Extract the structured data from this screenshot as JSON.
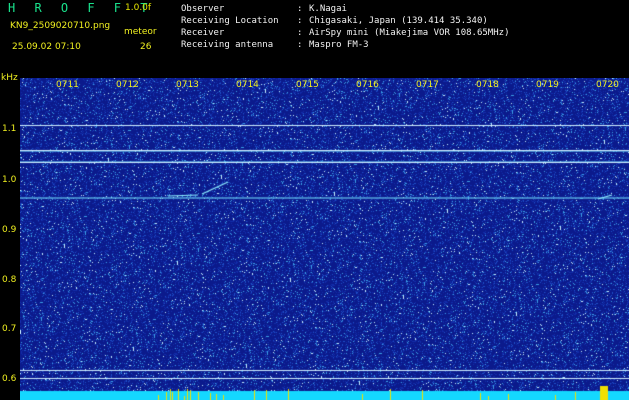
{
  "header": {
    "app_title": "H R O F F T",
    "version": "1.0.0f",
    "filename": "KN9_2509020710.png",
    "datetime": "25.09.02 07:10",
    "meteor_label": "meteor",
    "meteor_count": "26"
  },
  "info": [
    {
      "key": "Observer",
      "value": "K.Nagai"
    },
    {
      "key": "Receiving Location",
      "value": "Chigasaki, Japan (139.414 35.340)"
    },
    {
      "key": "Receiver",
      "value": "AirSpy mini (Miakejima VOR 108.65MHz)"
    },
    {
      "key": "Receiving antenna",
      "value": "Maspro FM-3"
    }
  ],
  "separator": ":",
  "axis": {
    "unit": "kHz",
    "y_ticks": [
      "1.1",
      "1.0",
      "0.9",
      "0.8",
      "0.7",
      "0.6"
    ],
    "time_ticks": [
      "0711",
      "0712",
      "0713",
      "0714",
      "0715",
      "0716",
      "0717",
      "0718",
      "0719",
      "0720"
    ]
  },
  "colors": {
    "background": "#0b1a8c",
    "carrier": "#9ff0ff",
    "label": "#f0f020",
    "title": "#19e28c"
  }
}
